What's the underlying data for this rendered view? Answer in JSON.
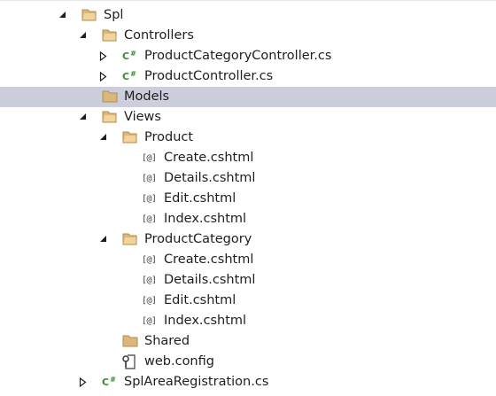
{
  "tree": {
    "items": [
      {
        "label": "Spl",
        "type": "folder-open",
        "expanded": true
      },
      {
        "label": "Controllers",
        "type": "folder-open",
        "expanded": true
      },
      {
        "label": "ProductCategoryController.cs",
        "type": "cs-file",
        "expanded": false
      },
      {
        "label": "ProductController.cs",
        "type": "cs-file",
        "expanded": false
      },
      {
        "label": "Models",
        "type": "folder",
        "selected": true
      },
      {
        "label": "Views",
        "type": "folder-open",
        "expanded": true
      },
      {
        "label": "Product",
        "type": "folder-open",
        "expanded": true
      },
      {
        "label": "Create.cshtml",
        "type": "cshtml-file"
      },
      {
        "label": "Details.cshtml",
        "type": "cshtml-file"
      },
      {
        "label": "Edit.cshtml",
        "type": "cshtml-file"
      },
      {
        "label": "Index.cshtml",
        "type": "cshtml-file"
      },
      {
        "label": "ProductCategory",
        "type": "folder-open",
        "expanded": true
      },
      {
        "label": "Create.cshtml",
        "type": "cshtml-file"
      },
      {
        "label": "Details.cshtml",
        "type": "cshtml-file"
      },
      {
        "label": "Edit.cshtml",
        "type": "cshtml-file"
      },
      {
        "label": "Index.cshtml",
        "type": "cshtml-file"
      },
      {
        "label": "Shared",
        "type": "folder"
      },
      {
        "label": "web.config",
        "type": "config-file"
      },
      {
        "label": "SplAreaRegistration.cs",
        "type": "cs-file",
        "expanded": false
      }
    ],
    "icon_text": {
      "cs": "C",
      "cs_hash": "#",
      "cshtml": "[@]"
    }
  },
  "colors": {
    "selection": "#cccedb",
    "folder": "#dcb67a",
    "csharp": "#388a34",
    "arrow": "#1e1e1e"
  }
}
